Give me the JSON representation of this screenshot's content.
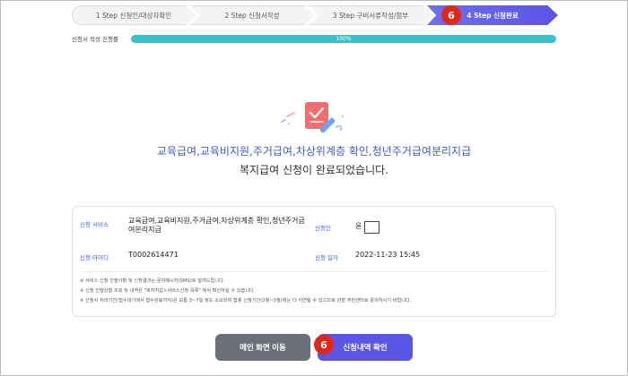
{
  "stepper": {
    "steps": [
      {
        "label": "1 Step 신청인/대상자확인"
      },
      {
        "label": "2 Step 신청서작성"
      },
      {
        "label": "3 Step 구비서류작성/첨부"
      },
      {
        "label": "4 Step 신청완료"
      }
    ],
    "marker": "6"
  },
  "progress": {
    "label": "신청서 작성 진행률",
    "percent_text": "100%",
    "fraction": 1.0
  },
  "completion": {
    "headline": "교육급여,교육비지원,주거급여,차상위계층 확인,청년주거급여분리지급",
    "subline": "복지급여 신청이 완료되었습니다."
  },
  "info": {
    "service_label": "신청 서비스",
    "service_value_line1": "교육급여,교육비지원,주거급여,차상위계층 확인,청년주거급",
    "service_value_line2": "여분리지급",
    "applicant_label": "신청인",
    "applicant_value": "윤",
    "id_label": "신청 아이디",
    "id_value": "T0002614471",
    "date_label": "신청 일자",
    "date_value": "2022-11-23 15:45",
    "notes": [
      "※ 서비스 신청 진행사항 및 신청결과는 문자메시지(SMS)로 알려드립니다.",
      "※ 신청 진행상황 조회 및 내역은 \"복지지갑>서비스신청 목록\" 에서 확인하실 수 있습니다.",
      "※ 신청서 처리기간(접수대기에서 접수완료까지)은 보통 3~7일 정도 소요되며 접종 신청기간(2월~3월)에는 더 지연될 수 있으므로 관할 주민센터로 문의하시기 바랍니다."
    ]
  },
  "buttons": {
    "main_label": "메인 화면 이동",
    "history_label": "신청내역 확인",
    "marker": "6"
  },
  "colors": {
    "accent": "#5a57e8",
    "progress": "#36c3cf",
    "marker": "#e42518",
    "headline": "#3f5bd8"
  }
}
